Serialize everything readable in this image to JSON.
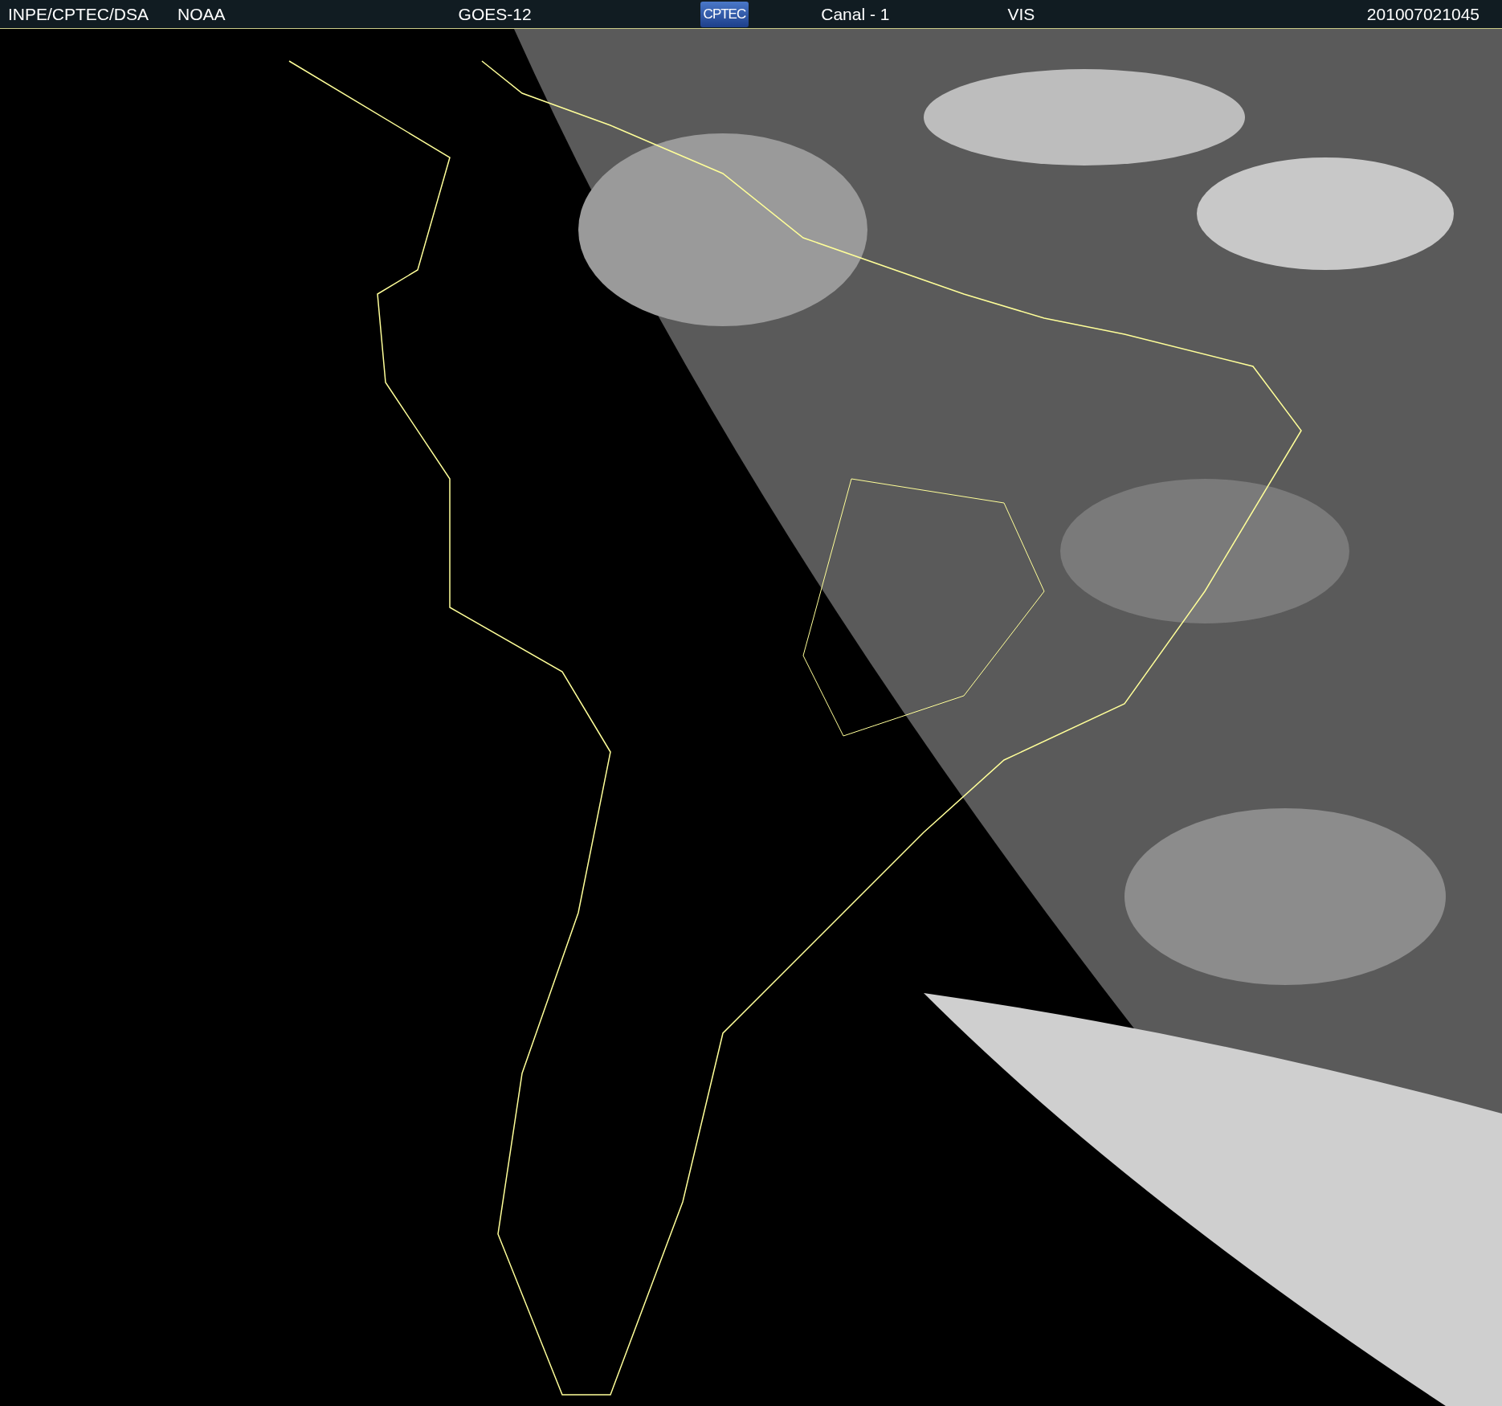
{
  "header": {
    "items": [
      {
        "kind": "text",
        "text": "INPE/CPTEC/DSA"
      },
      {
        "kind": "text",
        "text": "NOAA"
      },
      {
        "kind": "text",
        "text": "GOES-12"
      },
      {
        "kind": "logo",
        "text": "CPTEC"
      },
      {
        "kind": "text",
        "text": "Canal - 1"
      },
      {
        "kind": "text",
        "text": "VIS"
      },
      {
        "kind": "text",
        "text": "201007021045"
      }
    ]
  }
}
